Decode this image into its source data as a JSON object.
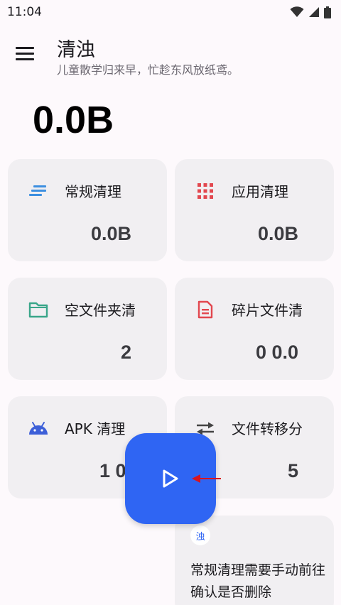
{
  "status_bar": {
    "time": "11:04",
    "icons": [
      "wifi-icon",
      "signal-icon",
      "battery-icon"
    ]
  },
  "app": {
    "title": "清浊",
    "subtitle": "儿童散学归来早，忙趁东风放纸鸢。",
    "menu_icon": "menu-icon"
  },
  "summary": {
    "total_size": "0.0B"
  },
  "cards": [
    {
      "id": "normal",
      "label": "常规清理",
      "value": "0.0B",
      "icon": "lines-icon",
      "color": "#3d8fe0"
    },
    {
      "id": "app",
      "label": "应用清理",
      "value": "0.0B",
      "icon": "grid-icon",
      "color": "#e2474f"
    },
    {
      "id": "empty-folder",
      "label": "空文件夹清",
      "value": "2",
      "icon": "folder-icon",
      "color": "#3aa68a"
    },
    {
      "id": "fragment",
      "label": "碎片文件清",
      "value": "0 0.0",
      "icon": "document-icon",
      "color": "#e2474f"
    },
    {
      "id": "apk",
      "label": "APK 清理",
      "value": "1 0.",
      "icon": "android-icon",
      "color": "#3d5fd8"
    },
    {
      "id": "transfer",
      "label": "文件转移分",
      "value": "5",
      "icon": "swap-icon",
      "color": "#444444"
    }
  ],
  "fab": {
    "icon": "play-icon",
    "color": "#2f65f3"
  },
  "annotation": {
    "icon": "arrow-left-icon",
    "color": "#d9141e"
  },
  "tip": {
    "avatar_text": "浊",
    "text": "常规清理需要手动前往确认是否删除"
  }
}
